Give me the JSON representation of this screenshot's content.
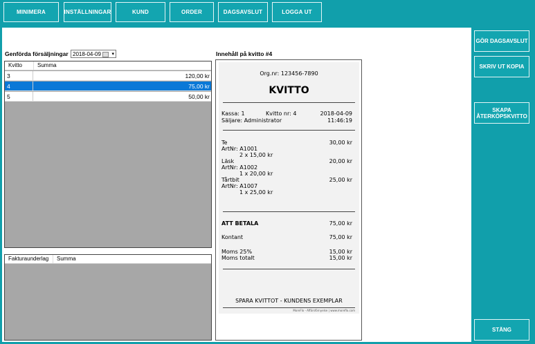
{
  "toolbar": {
    "minimize": "MINIMERA",
    "settings": "INSTÄLLNINGAR",
    "customer": "KUND",
    "order": "ORDER",
    "day_close": "DAGSAVSLUT",
    "logout": "LOGGA UT"
  },
  "sidebar": {
    "do_day_close": "GÖR DAGSAVSLUT",
    "print_copy": "SKRIV UT KOPIA",
    "create_return": "SKAPA ÅTERKÖPSKVITTO",
    "close": "STÄNG"
  },
  "sales": {
    "label": "Genförda försäljningar",
    "date": "2018-04-09",
    "columns": [
      "Kvitto",
      "Summa"
    ],
    "rows": [
      {
        "kvitto": "3",
        "summa": "120,00 kr"
      },
      {
        "kvitto": "4",
        "summa": "75,00 kr"
      },
      {
        "kvitto": "5",
        "summa": "50,00 kr"
      }
    ]
  },
  "invoice": {
    "columns": [
      "Fakturaunderlag",
      "Summa"
    ]
  },
  "receipt": {
    "heading": "Innehåll på kvitto #4",
    "org": "Org.nr: 123456-7890",
    "title": "KVITTO",
    "kassa": "Kassa:  1",
    "kvitto_nr": "Kvitto nr: 4",
    "date": "2018-04-09",
    "seller": "Säljare: Administrator",
    "time": "11:46:19",
    "items": [
      {
        "name": "Te",
        "artnr": "ArtNr: A1001",
        "qty": "2 x 15,00 kr",
        "total": "30,00 kr"
      },
      {
        "name": "Läsk",
        "artnr": "ArtNr: A1002",
        "qty": "1 x 20,00 kr",
        "total": "20,00 kr"
      },
      {
        "name": "Tårtbit",
        "artnr": "ArtNr: A1007",
        "qty": "1 x 25,00 kr",
        "total": "25,00 kr"
      }
    ],
    "to_pay_label": "ATT BETALA",
    "to_pay": "75,00 kr",
    "cash_label": "Kontant",
    "cash": "75,00 kr",
    "vat25_label": "Moms 25%",
    "vat25": "15,00 kr",
    "vat_total_label": "Moms totalt",
    "vat_total": "15,00 kr",
    "footer": "SPARA KVITTOT - KUNDENS EXEMPLAR",
    "small_print": "MoreFlo - Affärsförnyelse | www.moreflo.com"
  }
}
